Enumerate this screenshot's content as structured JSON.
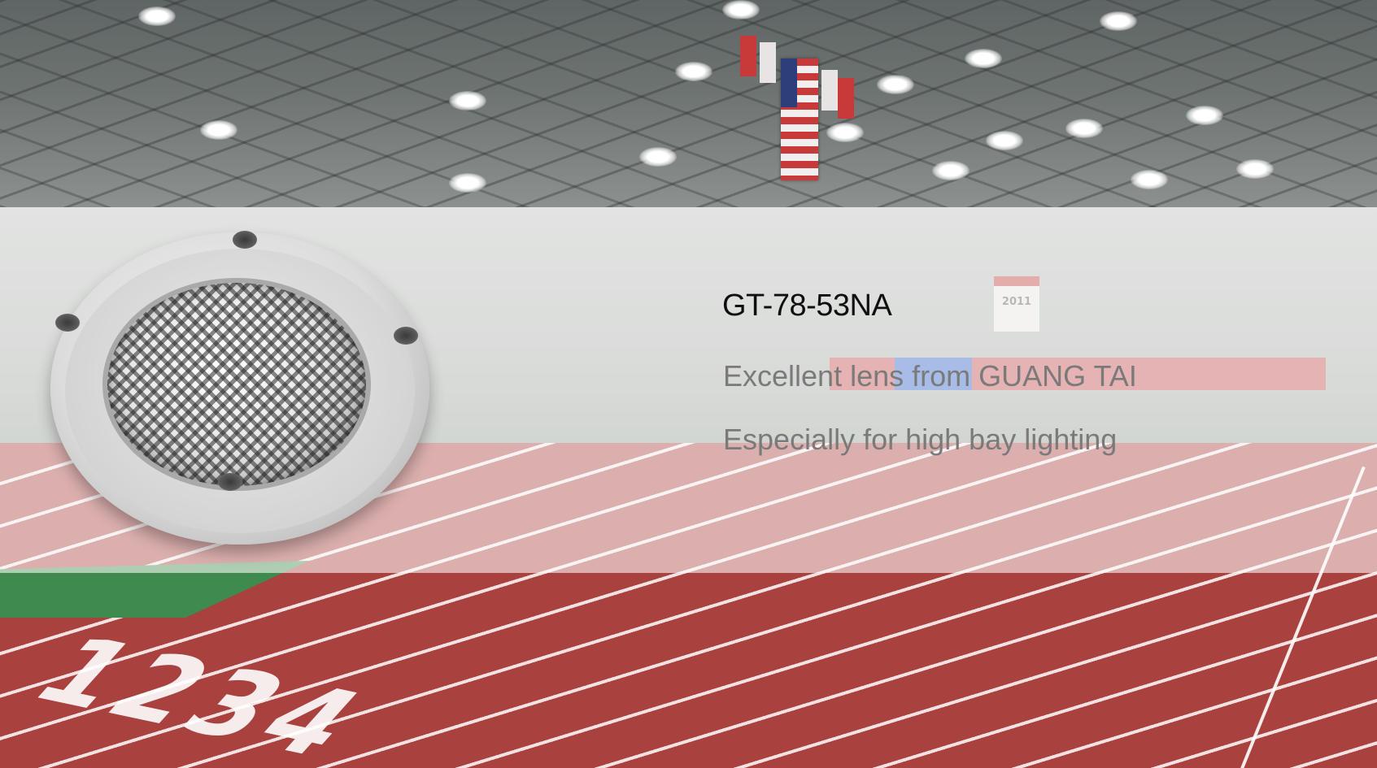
{
  "product": {
    "model": "GT-78-53NA",
    "tagline_1": "Excellent lens from GUANG TAI",
    "tagline_2": "Especially for high bay lighting"
  },
  "scene": {
    "banner_year": "2011",
    "lane_numbers": "1234"
  },
  "colors": {
    "overlay": "#ffffff",
    "model_text": "#0f0f0f",
    "tagline_text": "#7a7a7a",
    "track": "#a9423f",
    "infield": "#3f8a4e"
  }
}
